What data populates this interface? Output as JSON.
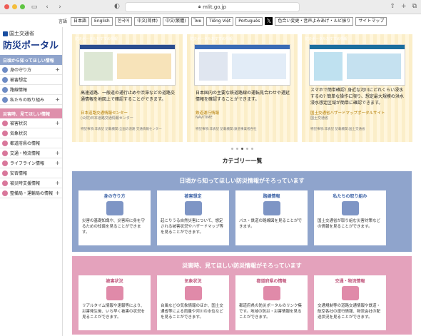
{
  "browser": {
    "url": "mlit.go.jp"
  },
  "lang_bar": {
    "label": "言語",
    "langs": [
      "日本語",
      "English",
      "한국어",
      "中文(简体)",
      "中文(繁體)",
      "ไทย",
      "Tiếng Việt",
      "Português"
    ],
    "x_icon": "𝕏",
    "extras": [
      "色合い変更・音声よみあげ・ルビ振り",
      "サイトマップ"
    ]
  },
  "sidebar": {
    "org": "国土交通省",
    "title": "防災ポータル",
    "section1": "日頃から知ってほしい情報",
    "items1": [
      {
        "label": "身の守り方",
        "color": "#6f8cc4",
        "plus": "+"
      },
      {
        "label": "被害想定",
        "color": "#6f8cc4",
        "plus": ""
      },
      {
        "label": "路線情報",
        "color": "#6f8cc4",
        "plus": ""
      },
      {
        "label": "私たちの取り組み",
        "color": "#6f8cc4",
        "plus": "+"
      }
    ],
    "section2": "災害時、見てほしい情報",
    "items2": [
      {
        "label": "被害状況",
        "color": "#d9779b",
        "plus": "+"
      },
      {
        "label": "気象状況",
        "color": "#d9779b",
        "plus": ""
      },
      {
        "label": "都道府県の情報",
        "color": "#d9779b",
        "plus": ""
      },
      {
        "label": "交通・物流情報",
        "color": "#d9779b",
        "plus": "+"
      },
      {
        "label": "ライフライン情報",
        "color": "#d9779b",
        "plus": "+"
      },
      {
        "label": "安否情報",
        "color": "#d9779b",
        "plus": ""
      },
      {
        "label": "被災時支援情報",
        "color": "#d9779b",
        "plus": "+"
      },
      {
        "label": "整備局・運輸局の情報",
        "color": "#d9779b",
        "plus": "+"
      }
    ]
  },
  "cards": [
    {
      "tag": "防災ポータルおすすめ情報",
      "desc": "高速道路、一般道の通行止めや渋滞などの道路交通情報を地図上で確認することができます。",
      "sub": "日本道路交通情報センター",
      "sub2": "(公財)日本道路交通情報センター",
      "foot": "特記事項:非表記 記載機関:全国の道路 交通情報センター"
    },
    {
      "tag": "防災ポータルおすすめ情報",
      "desc": "日本国内の主要な鉄道路線の運転見合わせや遅延情報を確認することができます。",
      "sub": "鉄道運行情報",
      "sub2": "NAVITIME",
      "foot": "特記事項:非表記 記載機関:鉄道事業者各社"
    },
    {
      "tag": "防災ポータルおすすめ情報",
      "desc": "スマホで簡単確認! 身近な河川にどれくらい浸水するの? 簡単な操作に限り、想定最大規模の洪水浸水想定区域が簡単に確認できます。",
      "sub": "国土交通省ハザードマップポータルサイト",
      "sub2": "国土交通省",
      "foot": "特記事項:非表記 記載機関:国土交通省"
    }
  ],
  "category_heading": "カテゴリー一覧",
  "band1": {
    "title": "日頃から知ってほしい防災情報がそろっています",
    "tiles": [
      {
        "title": "身の守り方",
        "desc": "災害の基礎知識や、災害時に身を守るための知識を見ることができます。",
        "icolor": "#7e95c5"
      },
      {
        "title": "被害想定",
        "desc": "起こりうる自然災害について、想定される被害状況やハザードマップ等を見ることができます。",
        "icolor": "#7e95c5"
      },
      {
        "title": "路線情報",
        "desc": "バス・鉄道の路線図を見ることができます。",
        "icolor": "#7e95c5"
      },
      {
        "title": "私たちの取り組み",
        "desc": "国土交通省が取り組む災害対策などの情報を見ることができます。",
        "icolor": "#7e95c5"
      }
    ]
  },
  "band2": {
    "title": "災害時、見てほしい防災情報がそろっています",
    "tiles": [
      {
        "title": "被害状況",
        "desc": "リアルタイム情報や速報等により、災害発生後、いち早く被害の状況を見ることができます。",
        "icolor": "#e08aa9"
      },
      {
        "title": "気象状況",
        "desc": "台風などの気象情報のほか、国土交通省等による雨量や河川の水位などを見ることができます。",
        "icolor": "#e08aa9"
      },
      {
        "title": "都道府県の情報",
        "desc": "都道府県の防災ポータルのリンク集です。地域の防災・災害情報を見ることができます。",
        "icolor": "#e08aa9"
      },
      {
        "title": "交通・物流情報",
        "desc": "交通規制等の道路交通情報や鉄道・航空各社の運行情報、物流会社の配送状況を見ることができます。",
        "icolor": "#e08aa9"
      }
    ]
  }
}
